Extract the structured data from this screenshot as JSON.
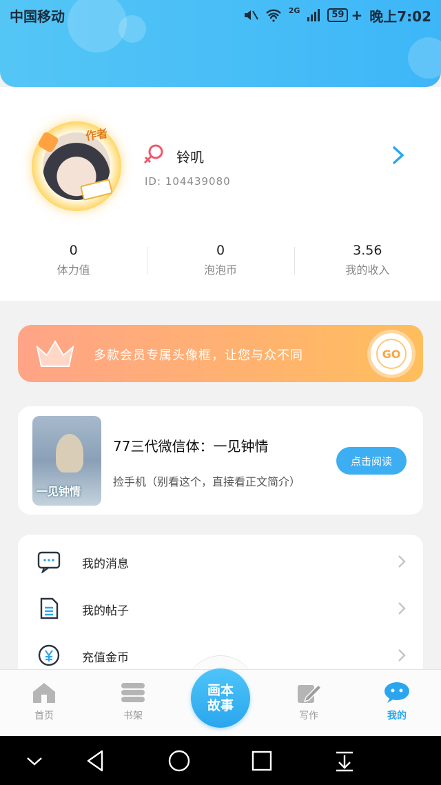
{
  "status_bar": {
    "carrier": "中国移动",
    "network": "2G",
    "battery": "59",
    "time": "晚上7:02"
  },
  "profile": {
    "author_badge": "作者",
    "username": "铃叽",
    "id_text": "ID: 104439080",
    "stats": [
      {
        "value": "0",
        "label": "体力值"
      },
      {
        "value": "0",
        "label": "泡泡币"
      },
      {
        "value": "3.56",
        "label": "我的收入"
      }
    ]
  },
  "vip_banner": {
    "text": "多款会员专属头像框，让您与众不同",
    "go_label": "GO"
  },
  "book": {
    "cover_text": "一见钟情",
    "title": "77三代微信体：一见钟情",
    "description": "捡手机（别看这个，直接看正文简介）",
    "read_button": "点击阅读"
  },
  "menu": [
    {
      "label": "我的消息",
      "icon": "message-icon"
    },
    {
      "label": "我的帖子",
      "icon": "document-icon"
    },
    {
      "label": "充值金币",
      "icon": "coin-icon"
    }
  ],
  "tabbar": {
    "tabs": [
      {
        "label": "首页",
        "icon": "home-icon"
      },
      {
        "label": "书架",
        "icon": "bookshelf-icon"
      },
      {
        "label": "写作",
        "icon": "pen-icon"
      },
      {
        "label": "我的",
        "icon": "chat-bubble-icon"
      }
    ],
    "center_line1": "画本",
    "center_line2": "故事"
  },
  "colors": {
    "accent": "#2aa6ee",
    "header": "#47bdf7",
    "vip_gradient_start": "#ffa487",
    "vip_gradient_end": "#ffbe5c"
  }
}
